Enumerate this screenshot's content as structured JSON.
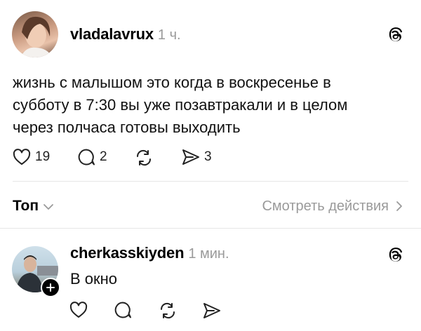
{
  "post": {
    "username": "vladalavrux",
    "time": "1 ч.",
    "text_lines": [
      "жизнь с малышом это когда в воскресенье в",
      "субботу в 7:30 вы уже позавтракали и в целом",
      "через полчаса готовы выходить"
    ],
    "likes": "19",
    "comments": "2",
    "shares": "3"
  },
  "filter_bar": {
    "sort_label": "Топ",
    "activity_link": "Смотреть действия"
  },
  "reply": {
    "username": "cherkasskiyden",
    "time": "1 мин.",
    "text": "В окно"
  },
  "icons": {
    "threads": "threads-logo-icon",
    "like": "heart-icon",
    "comment": "comment-bubble-icon",
    "repost": "repost-icon",
    "share": "send-icon",
    "chevron_down": "chevron-down-icon",
    "chevron_right": "chevron-right-icon",
    "follow": "plus-icon"
  }
}
